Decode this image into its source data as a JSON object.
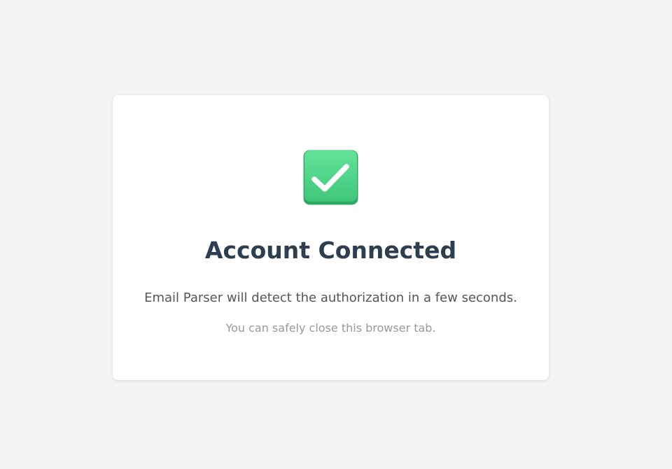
{
  "status": {
    "title": "Account Connected",
    "message": "Email Parser will detect the authorization in a few seconds.",
    "note": "You can safely close this browser tab.",
    "icon": "check-mark-icon"
  },
  "colors": {
    "background": "#f4f4f4",
    "card": "#ffffff",
    "title": "#2c3e50",
    "message": "#555555",
    "note": "#999999",
    "success": "#4cd385"
  }
}
